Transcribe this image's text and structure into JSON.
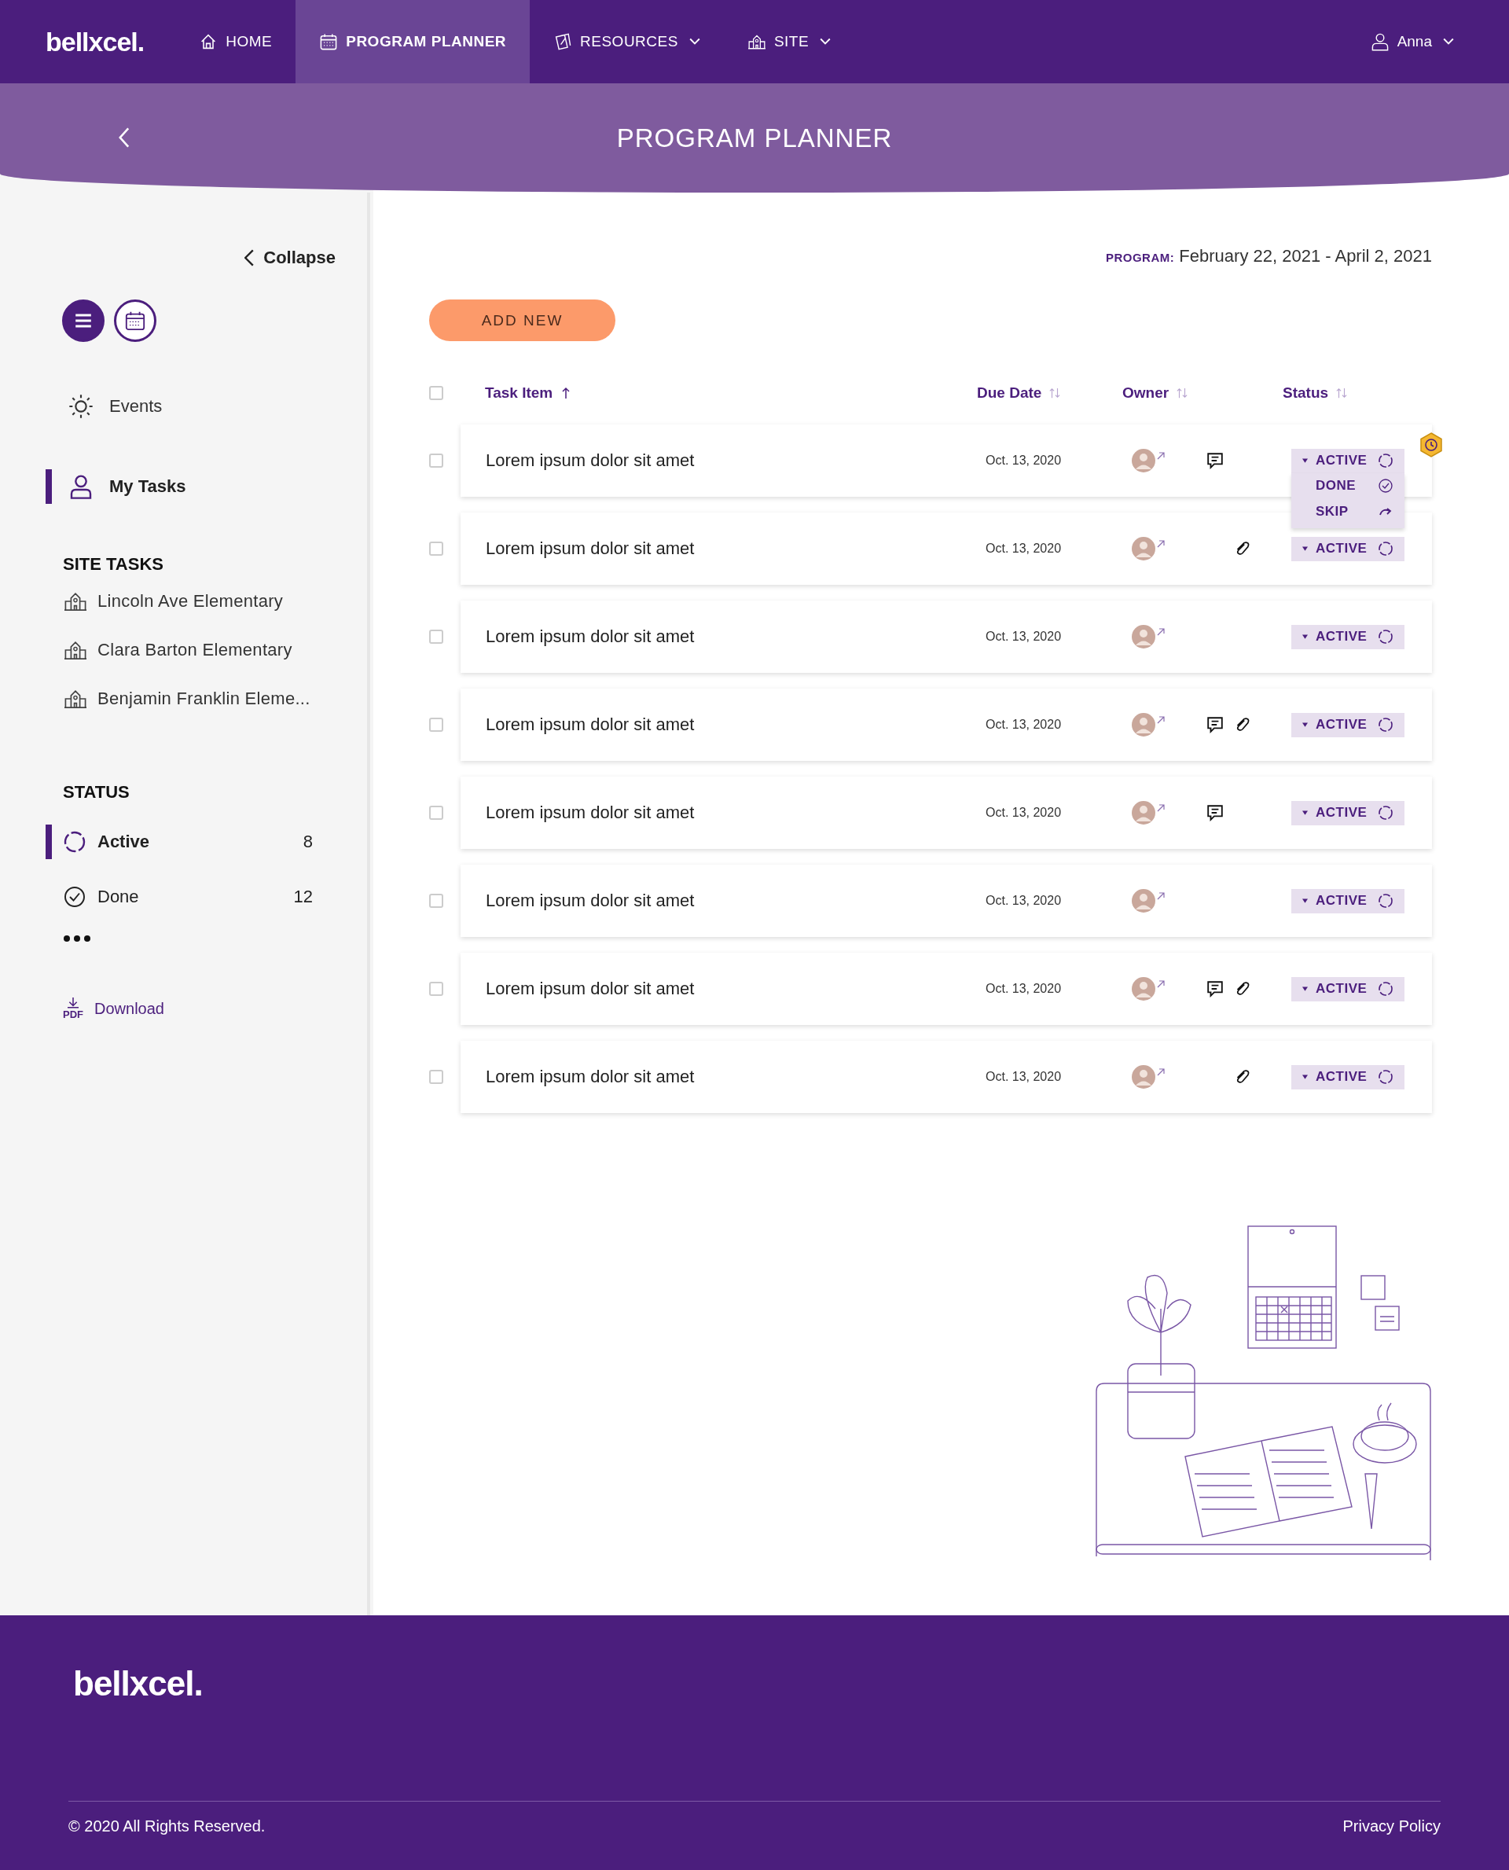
{
  "nav": {
    "logo": "bellxcel.",
    "items": [
      {
        "label": "HOME",
        "dropdown": false,
        "selected": false
      },
      {
        "label": "PROGRAM PLANNER",
        "dropdown": false,
        "selected": true
      },
      {
        "label": "RESOURCES",
        "dropdown": true,
        "selected": false
      },
      {
        "label": "SITE",
        "dropdown": true,
        "selected": false
      }
    ],
    "user": "Anna"
  },
  "page_title": "PROGRAM PLANNER",
  "sidebar": {
    "collapse": "Collapse",
    "views": [
      {
        "kind": "list",
        "selected": true
      },
      {
        "kind": "calendar",
        "selected": false
      }
    ],
    "items": [
      {
        "label": "Events",
        "selected": false
      },
      {
        "label": "My Tasks",
        "selected": true
      }
    ],
    "site_tasks_heading": "SITE TASKS",
    "sites": [
      "Lincoln Ave Elementary",
      "Clara Barton Elementary",
      "Benjamin Franklin Eleme..."
    ],
    "status_heading": "STATUS",
    "statuses": [
      {
        "label": "Active",
        "count": "8",
        "kind": "active",
        "selected": true
      },
      {
        "label": "Done",
        "count": "12",
        "kind": "done",
        "selected": false
      }
    ],
    "download_badge": "PDF",
    "download": "Download"
  },
  "program": {
    "label": "PROGRAM:",
    "range": "February 22, 2021 - April 2, 2021"
  },
  "add_button": "ADD NEW",
  "table": {
    "all_checked": false,
    "columns": [
      {
        "label": "Task Item",
        "sorted": true
      },
      {
        "label": "Due Date",
        "sorted": false
      },
      {
        "label": "Owner",
        "sorted": false
      },
      {
        "label": "Status",
        "sorted": false
      }
    ],
    "rows": [
      {
        "task": "Lorem ipsum dolor sit amet",
        "due": "Oct. 13, 2020",
        "comment": true,
        "attachment": false,
        "status": "ACTIVE",
        "checked": false,
        "reminder": true,
        "menu": [
          {
            "label": "DONE",
            "kind": "done"
          },
          {
            "label": "SKIP",
            "kind": "skip"
          }
        ]
      },
      {
        "task": "Lorem ipsum dolor sit amet",
        "due": "Oct. 13, 2020",
        "comment": false,
        "attachment": true,
        "status": "ACTIVE",
        "checked": false,
        "reminder": false
      },
      {
        "task": "Lorem ipsum dolor sit amet",
        "due": "Oct. 13, 2020",
        "comment": false,
        "attachment": false,
        "status": "ACTIVE",
        "checked": false,
        "reminder": false
      },
      {
        "task": "Lorem ipsum dolor sit amet",
        "due": "Oct. 13, 2020",
        "comment": true,
        "attachment": true,
        "status": "ACTIVE",
        "checked": false,
        "reminder": false
      },
      {
        "task": "Lorem ipsum dolor sit amet",
        "due": "Oct. 13, 2020",
        "comment": true,
        "attachment": false,
        "status": "ACTIVE",
        "checked": false,
        "reminder": false
      },
      {
        "task": "Lorem ipsum dolor sit amet",
        "due": "Oct. 13, 2020",
        "comment": false,
        "attachment": false,
        "status": "ACTIVE",
        "checked": false,
        "reminder": false
      },
      {
        "task": "Lorem ipsum dolor sit amet",
        "due": "Oct. 13, 2020",
        "comment": true,
        "attachment": true,
        "status": "ACTIVE",
        "checked": false,
        "reminder": false
      },
      {
        "task": "Lorem ipsum dolor sit amet",
        "due": "Oct. 13, 2020",
        "comment": false,
        "attachment": true,
        "status": "ACTIVE",
        "checked": false,
        "reminder": false
      }
    ]
  },
  "footer": {
    "logo": "bellxcel.",
    "copyright": "© 2020 All Rights Reserved.",
    "privacy": "Privacy Policy"
  }
}
